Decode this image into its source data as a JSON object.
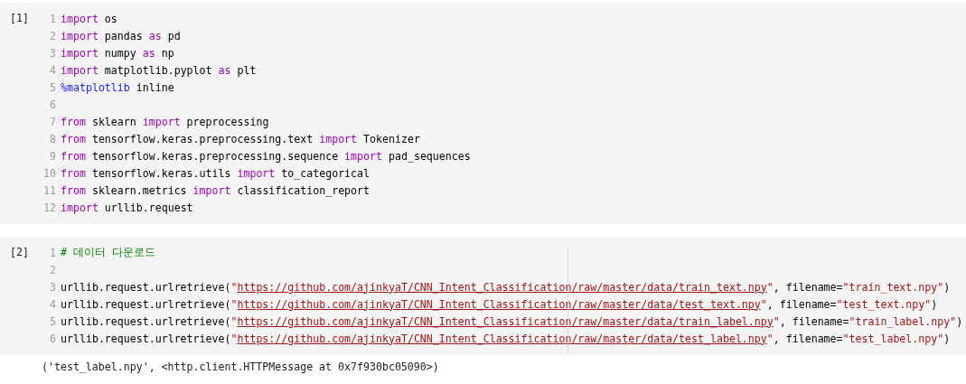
{
  "cells": [
    {
      "count": "[1]",
      "lines": [
        {
          "number": "1",
          "tokens": [
            {
              "kind": "keyword",
              "text": "import"
            },
            {
              "kind": "plain",
              "text": " os"
            }
          ]
        },
        {
          "number": "2",
          "tokens": [
            {
              "kind": "keyword",
              "text": "import"
            },
            {
              "kind": "plain",
              "text": " pandas "
            },
            {
              "kind": "keyword",
              "text": "as"
            },
            {
              "kind": "plain",
              "text": " pd"
            }
          ]
        },
        {
          "number": "3",
          "tokens": [
            {
              "kind": "keyword",
              "text": "import"
            },
            {
              "kind": "plain",
              "text": " numpy "
            },
            {
              "kind": "keyword",
              "text": "as"
            },
            {
              "kind": "plain",
              "text": " np"
            }
          ]
        },
        {
          "number": "4",
          "tokens": [
            {
              "kind": "keyword",
              "text": "import"
            },
            {
              "kind": "plain",
              "text": " matplotlib.pyplot "
            },
            {
              "kind": "keyword",
              "text": "as"
            },
            {
              "kind": "plain",
              "text": " plt"
            }
          ]
        },
        {
          "number": "5",
          "tokens": [
            {
              "kind": "magic",
              "text": "%matplotlib"
            },
            {
              "kind": "plain",
              "text": " inline"
            }
          ]
        },
        {
          "number": "6"
        },
        {
          "number": "7",
          "tokens": [
            {
              "kind": "keyword",
              "text": "from"
            },
            {
              "kind": "plain",
              "text": " sklearn "
            },
            {
              "kind": "keyword",
              "text": "import"
            },
            {
              "kind": "plain",
              "text": " preprocessing"
            }
          ]
        },
        {
          "number": "8",
          "tokens": [
            {
              "kind": "keyword",
              "text": "from"
            },
            {
              "kind": "plain",
              "text": " tensorflow.keras.preprocessing.text "
            },
            {
              "kind": "keyword",
              "text": "import"
            },
            {
              "kind": "plain",
              "text": " Tokenizer"
            }
          ]
        },
        {
          "number": "9",
          "tokens": [
            {
              "kind": "keyword",
              "text": "from"
            },
            {
              "kind": "plain",
              "text": " tensorflow.keras.preprocessing.sequence "
            },
            {
              "kind": "keyword",
              "text": "import"
            },
            {
              "kind": "plain",
              "text": " pad_sequences"
            }
          ]
        },
        {
          "number": "10",
          "tokens": [
            {
              "kind": "keyword",
              "text": "from"
            },
            {
              "kind": "plain",
              "text": " tensorflow.keras.utils "
            },
            {
              "kind": "keyword",
              "text": "import"
            },
            {
              "kind": "plain",
              "text": " to_categorical"
            }
          ]
        },
        {
          "number": "11",
          "tokens": [
            {
              "kind": "keyword",
              "text": "from"
            },
            {
              "kind": "plain",
              "text": " sklearn.metrics "
            },
            {
              "kind": "keyword",
              "text": "import"
            },
            {
              "kind": "plain",
              "text": " classification_report"
            }
          ]
        },
        {
          "number": "12",
          "tokens": [
            {
              "kind": "keyword",
              "text": "import"
            },
            {
              "kind": "plain",
              "text": " urllib.request"
            }
          ]
        }
      ]
    },
    {
      "count": "[2]",
      "lines": [
        {
          "number": "1",
          "tokens": [
            {
              "kind": "comment",
              "text": "# 데이터 다운로드"
            }
          ]
        },
        {
          "number": "2"
        },
        {
          "number": "3",
          "tokens": [
            {
              "kind": "plain",
              "text": "urllib.request.urlretrieve("
            },
            {
              "kind": "string",
              "text": "\""
            },
            {
              "kind": "link",
              "text": "https://github.com/ajinkyaT/CNN_Intent_Classification/raw/master/data/train_text.npy"
            },
            {
              "kind": "string",
              "text": "\""
            },
            {
              "kind": "plain",
              "text": ", filename="
            },
            {
              "kind": "string",
              "text": "\"train_text.npy\""
            },
            {
              "kind": "plain",
              "text": ")"
            }
          ]
        },
        {
          "number": "4",
          "tokens": [
            {
              "kind": "plain",
              "text": "urllib.request.urlretrieve("
            },
            {
              "kind": "string",
              "text": "\""
            },
            {
              "kind": "link",
              "text": "https://github.com/ajinkyaT/CNN_Intent_Classification/raw/master/data/test_text.npy"
            },
            {
              "kind": "string",
              "text": "\""
            },
            {
              "kind": "plain",
              "text": ", filename="
            },
            {
              "kind": "string",
              "text": "\"test_text.npy\""
            },
            {
              "kind": "plain",
              "text": ")"
            }
          ]
        },
        {
          "number": "5",
          "tokens": [
            {
              "kind": "plain",
              "text": "urllib.request.urlretrieve("
            },
            {
              "kind": "string",
              "text": "\""
            },
            {
              "kind": "link",
              "text": "https://github.com/ajinkyaT/CNN_Intent_Classification/raw/master/data/train_label.npy"
            },
            {
              "kind": "string",
              "text": "\""
            },
            {
              "kind": "plain",
              "text": ", filename="
            },
            {
              "kind": "string",
              "text": "\"train_label.npy\""
            },
            {
              "kind": "plain",
              "text": ")"
            }
          ]
        },
        {
          "number": "6",
          "tokens": [
            {
              "kind": "plain",
              "text": "urllib.request.urlretrieve("
            },
            {
              "kind": "string",
              "text": "\""
            },
            {
              "kind": "link",
              "text": "https://github.com/ajinkyaT/CNN_Intent_Classification/raw/master/data/test_label.npy"
            },
            {
              "kind": "string",
              "text": "\""
            },
            {
              "kind": "plain",
              "text": ", filename="
            },
            {
              "kind": "string",
              "text": "\"test_label.npy\""
            },
            {
              "kind": "plain",
              "text": ")"
            }
          ]
        }
      ],
      "output": "('test_label.npy', <http.client.HTTPMessage at 0x7f930bc05090>)"
    }
  ]
}
